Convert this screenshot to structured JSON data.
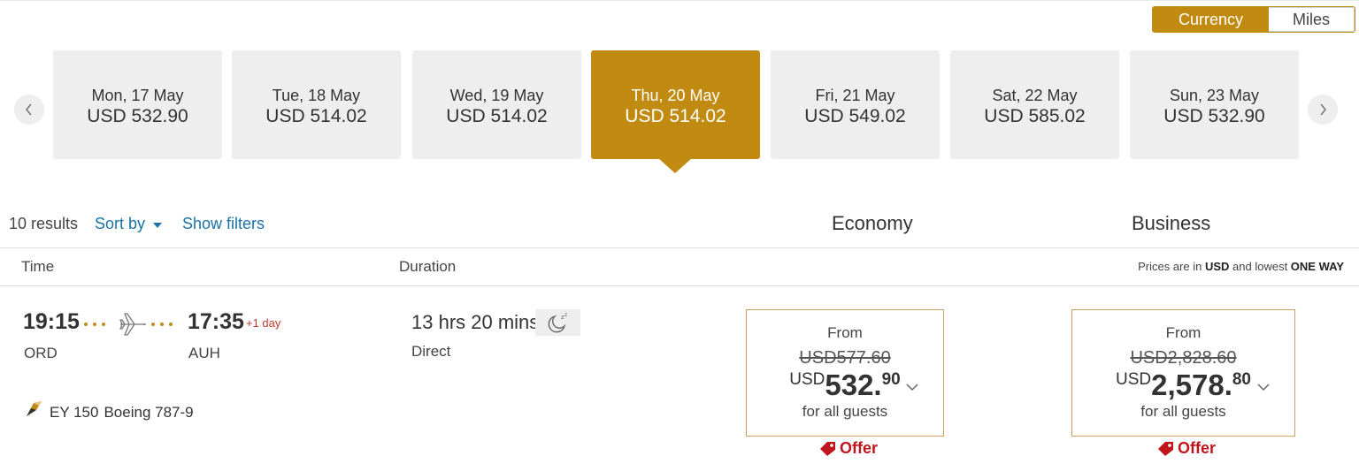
{
  "toggle": {
    "currency_label": "Currency",
    "miles_label": "Miles",
    "active": "Currency"
  },
  "dates": [
    {
      "day": "Mon, 17 May",
      "price": "USD 532.90",
      "selected": false
    },
    {
      "day": "Tue, 18 May",
      "price": "USD 514.02",
      "selected": false
    },
    {
      "day": "Wed, 19 May",
      "price": "USD 514.02",
      "selected": false
    },
    {
      "day": "Thu, 20 May",
      "price": "USD 514.02",
      "selected": true
    },
    {
      "day": "Fri, 21 May",
      "price": "USD 549.02",
      "selected": false
    },
    {
      "day": "Sat, 22 May",
      "price": "USD 585.02",
      "selected": false
    },
    {
      "day": "Sun, 23 May",
      "price": "USD 532.90",
      "selected": false
    }
  ],
  "results": {
    "count_label": "10 results",
    "sort_label": "Sort by",
    "filters_label": "Show filters"
  },
  "cabins": {
    "economy": "Economy",
    "business": "Business"
  },
  "columns": {
    "time": "Time",
    "duration": "Duration",
    "note_prefix": "Prices are in ",
    "note_currency": "USD",
    "note_mid": " and lowest ",
    "note_trip": "ONE WAY"
  },
  "flight": {
    "departure_time": "19:15",
    "arrival_time": "17:35",
    "day_offset": "+1 day",
    "origin": "ORD",
    "destination": "AUH",
    "duration": "13 hrs 20 mins",
    "stops": "Direct",
    "flight_number": "EY 150",
    "aircraft": "Boeing 787-9",
    "economy": {
      "from_label": "From",
      "old_price": "USD577.60",
      "currency": "USD",
      "price_int": "532.",
      "price_dec": "90",
      "guests_label": "for all guests",
      "offer_label": "Offer"
    },
    "business": {
      "from_label": "From",
      "old_price": "USD2,828.60",
      "currency": "USD",
      "price_int": "2,578.",
      "price_dec": "80",
      "guests_label": "for all guests",
      "offer_label": "Offer"
    }
  },
  "colors": {
    "accent": "#c18b12",
    "link": "#1a72a6",
    "offer": "#c0151d",
    "card": "#eeeeee"
  },
  "icons": [
    "chevron-left-icon",
    "chevron-right-icon",
    "plane-icon",
    "overnight-icon",
    "airline-tail-icon",
    "chevron-down-icon",
    "offer-tag-icon"
  ]
}
